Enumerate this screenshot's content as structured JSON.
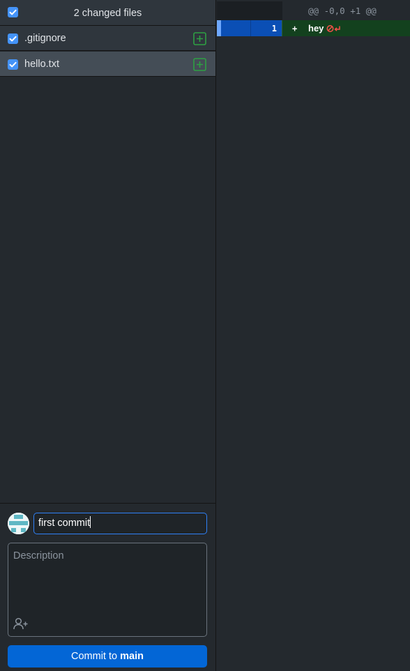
{
  "changes": {
    "header_title": "2 changed files",
    "files": [
      {
        "name": ".gitignore",
        "status": "added"
      },
      {
        "name": "hello.txt",
        "status": "added"
      }
    ]
  },
  "commit": {
    "summary_value": "first commit",
    "description_placeholder": "Description",
    "button_prefix": "Commit to",
    "button_branch": "main"
  },
  "diff": {
    "hunk_header": "@@ -0,0 +1 @@",
    "lines": [
      {
        "new_number": "1",
        "marker": "+",
        "content": "hey"
      }
    ]
  },
  "colors": {
    "accent": "#0366d6",
    "added": "#2ea043",
    "added_line_bg": "#13411e",
    "selected_gutter": "#0b4fb5",
    "no_newline_warning": "#f85149"
  },
  "icons": {
    "select_all": "checkbox-checked-icon",
    "file_status": "file-added-icon",
    "coauthor": "add-coauthor-icon",
    "no_newline": "no-newline-at-end-icon"
  }
}
